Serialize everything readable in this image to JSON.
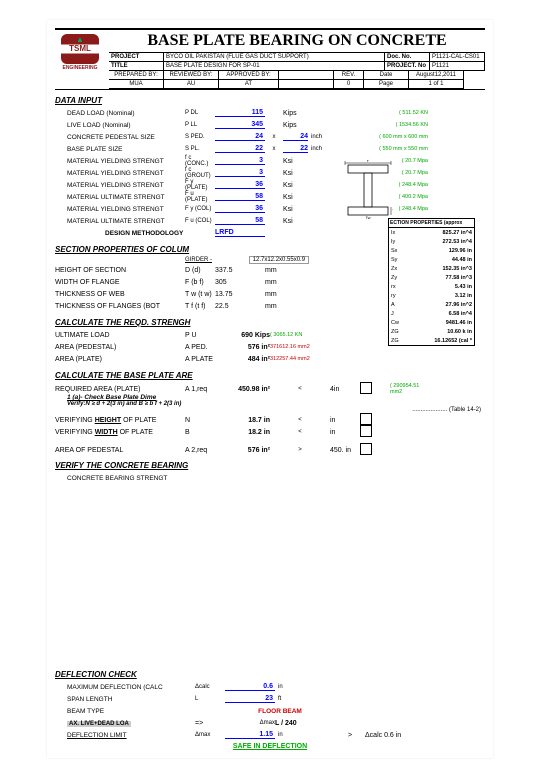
{
  "header": {
    "title": "BASE PLATE BEARING ON CONCRETE",
    "project_lab": "PROJECT",
    "project": "BYCO OIL PAKISTAN (FLUE GAS DUCT SUPPORT)",
    "title_lab": "TITLE",
    "doc_title": "BASE PLATE DESIGN FOR SP-01",
    "docno_lab": "Doc. No.",
    "docno": "P1121-CAL-CS01",
    "projno_lab": "PROJECT. No",
    "projno": "P1121",
    "prep_lab": "PREPARED BY:",
    "prep": "MUA",
    "rev_by_lab": "REVIEWED BY:",
    "rev_by": "AU",
    "app_lab": "APPROVED BY:",
    "app": "AT",
    "rev_lab": "REV.",
    "rev": "0",
    "date_lab": "Date",
    "date": "August12,2011",
    "page_lab": "Page",
    "page": "1 of 1",
    "logo": "TSML",
    "logo_sub": "ENGINEERING"
  },
  "data_input": {
    "h": "DATA INPUT",
    "rows": [
      {
        "lab": "DEAD LOAD (Nominal)",
        "sym": "P DL",
        "v": "115",
        "u": "Kips",
        "note": "( 511.52 KN"
      },
      {
        "lab": "LIVE LOAD (Nominal)",
        "sym": "P LL",
        "v": "345",
        "u": "Kips",
        "note": "( 1534.56 KN"
      },
      {
        "lab": "CONCRETE PEDESTAL SIZE",
        "sym": "S PED.",
        "v": "24",
        "x": "x",
        "v2": "24",
        "u": "inch",
        "note": "( 600 mm x 600 mm"
      },
      {
        "lab": "BASE PLATE SIZE",
        "sym": "S PL.",
        "v": "22",
        "x": "x",
        "v2": "22",
        "u": "inch",
        "note": "( 550 mm x 550 mm"
      },
      {
        "lab": "MATERIAL YIELDING STRENGT",
        "sym": "f c (CONC.)",
        "v": "3",
        "u": "Ksi",
        "note": "( 20.7 Mpa"
      },
      {
        "lab": "MATERIAL YIELDING STRENGT",
        "sym": "f c (GROUT)",
        "v": "3",
        "u": "Ksi",
        "note": "( 20.7 Mpa"
      },
      {
        "lab": "MATERIAL YIELDING STRENGT",
        "sym": "F y (PLATE)",
        "v": "36",
        "u": "Ksi",
        "note": "( 248.4 Mpa"
      },
      {
        "lab": "MATERIAL ULTIMATE STRENGT",
        "sym": "F u (PLATE)",
        "v": "58",
        "u": "Ksi",
        "note": "( 400.2 Mpa"
      },
      {
        "lab": "MATERIAL YIELDING STRENGT",
        "sym": "F y (COL)",
        "v": "36",
        "u": "Ksi",
        "note": "( 248.4 Mpa"
      },
      {
        "lab": "MATERIAL ULTIMATE STRENGT",
        "sym": "F u (COL)",
        "v": "58",
        "u": "Ksi",
        "note": "( 400.2 Mpa"
      }
    ],
    "method_lab": "DESIGN METHODOLOGY",
    "method": "LRFD"
  },
  "section": {
    "h": "SECTION PROPERTIES OF COLUM",
    "girder_lab": "GIRDER -",
    "girder": "12.7x12.2x0.55x0.9",
    "rows": [
      {
        "lab": "HEIGHT OF SECTION",
        "sym": "D  (d)",
        "v": "337.5",
        "u": "mm"
      },
      {
        "lab": "WIDTH OF FLANGE",
        "sym": "F (b f)",
        "v": "305",
        "u": "mm"
      },
      {
        "lab": "THICKNESS OF WEB",
        "sym": "T w (t w)",
        "v": "13.75",
        "u": "mm"
      },
      {
        "lab": "THICKNESS OF FLANGES (BOT",
        "sym": "T f (t f)",
        "v": "22.5",
        "u": "mm"
      }
    ]
  },
  "props": {
    "h": "ECTION PROPERTIES (approx",
    "rows": [
      {
        "s": "Ix",
        "v": "825.27 in^4"
      },
      {
        "s": "Iy",
        "v": "272.53 in^4"
      },
      {
        "s": "Sx",
        "v": "129.96 in"
      },
      {
        "s": "Sy",
        "v": "44.48 in"
      },
      {
        "s": "Zx",
        "v": "152.35 in^3"
      },
      {
        "s": "Zy",
        "v": "77.58 in^3"
      },
      {
        "s": "rx",
        "v": "5.43 in"
      },
      {
        "s": "ry",
        "v": "3.12 in"
      },
      {
        "s": "A",
        "v": "27.96 in^2"
      },
      {
        "s": "J",
        "v": "6.58 in^4"
      },
      {
        "s": "Cw",
        "v": "9481.46 in"
      },
      {
        "s": "ZG",
        "v": "10.60 k in"
      },
      {
        "s": "ZG",
        "v": "16.12652 (cal *"
      }
    ]
  },
  "reqd": {
    "h": "CALCULATE THE REQD. STRENGH",
    "rows": [
      {
        "lab": "ULTIMATE LOAD",
        "sym": "P U",
        "v": "690",
        "u": "Kips",
        "ext": "( 3065.12 KN"
      },
      {
        "lab": "AREA (PEDESTAL)",
        "sym": "A PED.",
        "v": "576",
        "u": "in²",
        "ext": "371612.16 mm2"
      },
      {
        "lab": "AREA (PLATE)",
        "sym": "A PLATE",
        "v": "484",
        "u": "in²",
        "ext": "312257.44 mm2"
      }
    ]
  },
  "bpa": {
    "h": "CALCULATE THE BASE PLATE ARE",
    "req_lab": "REQUIRED AREA (PLATE)",
    "req_sym": "A 1,req",
    "req_v": "450.98",
    "req_u": "in²",
    "req_op": "<",
    "req_cmp": "4in",
    "req_note": "( 290954.51 mm2",
    "check": "1 (a)- Check Base Plate Dime",
    "verify": "Verify:N ≥ d + 2(3 in)  and  B ≥ b f + 2(3 in)",
    "table": "..................... (Table 14-2)",
    "vh_lab": "VERIFYING HEIGHT OF PLATE",
    "vh_sym": "N",
    "vh_v": "18.7",
    "vh_u": "in",
    "vh_op": "<",
    "vh_u2": "in",
    "vw_lab": "VERIFYING WIDTH OF PLATE",
    "vw_sym": "B",
    "vw_v": "18.2",
    "vw_u": "in",
    "vw_op": "<",
    "vw_u2": "in",
    "ap_lab": "AREA OF PEDESTAL",
    "ap_sym": "A 2,req",
    "ap_v": "576",
    "ap_u": "in²",
    "ap_op": ">",
    "ap_cmp": "450. in"
  },
  "vcb": {
    "h": "VERIFY THE CONCRETE BEARING",
    "sub": "CONCRETE BEARING STRENGT"
  },
  "defl": {
    "h": "DEFLECTION CHECK",
    "r1_lab": "MAXIMUM DEFLECTION (CALC",
    "r1_sym": "Δcalc",
    "r1_v": "0.6",
    "r1_u": "in",
    "r2_lab": "SPAN LENGTH",
    "r2_sym": "L",
    "r2_v": "23",
    "r2_u": "ft",
    "r3_lab": "BEAM TYPE",
    "r3_v": "FLOOR BEAM",
    "r4_lab": "AX. LIVE+DEAD LOA",
    "r4_arrow": "=>",
    "r4_sym": "Δmax",
    "r4_v": "L / 240",
    "r5_lab": "DEFLECTION LIMIT",
    "r5_sym": "Δmax",
    "r5_v": "1.15",
    "r5_u": "in",
    "r5_op": ">",
    "r5_cmp": "Δcalc 0.6 in",
    "safe": "SAFE IN DEFLECTION"
  }
}
